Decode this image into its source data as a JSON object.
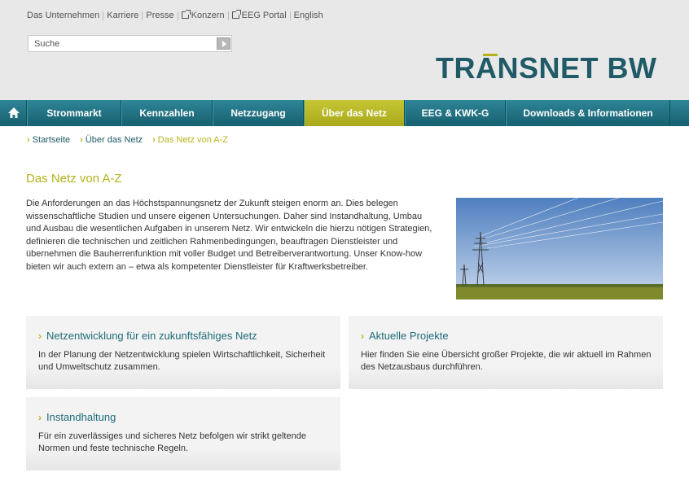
{
  "header": {
    "top_links": [
      {
        "label": "Das Unternehmen",
        "external": false
      },
      {
        "label": "Karriere",
        "external": false
      },
      {
        "label": "Presse",
        "external": false
      },
      {
        "label": "Konzern",
        "external": true
      },
      {
        "label": "EEG Portal",
        "external": true
      },
      {
        "label": "English",
        "external": false
      }
    ],
    "search": {
      "placeholder": "Suche"
    },
    "logo": {
      "text": "TRANSNET BW"
    }
  },
  "nav": {
    "home_icon": "home-icon",
    "items": [
      {
        "label": "Strommarkt",
        "active": false
      },
      {
        "label": "Kennzahlen",
        "active": false
      },
      {
        "label": "Netzzugang",
        "active": false
      },
      {
        "label": "Über das Netz",
        "active": true
      },
      {
        "label": "EEG & KWK-G",
        "active": false
      },
      {
        "label": "Downloads & Informationen",
        "active": false
      }
    ]
  },
  "breadcrumb": [
    {
      "label": "Startseite"
    },
    {
      "label": "Über das Netz"
    },
    {
      "label": "Das Netz von A-Z"
    }
  ],
  "main": {
    "title": "Das Netz von A-Z",
    "intro": "Die Anforderungen an das Höchstspannungsnetz der Zukunft steigen enorm an. Dies belegen wissenschaftliche Studien und unsere eigenen Untersuchungen. Daher sind Instandhaltung, Umbau und Ausbau die wesentlichen Aufgaben in unserem Netz. Wir entwickeln die hierzu nötigen Strategien, definieren die technischen und zeitlichen Rahmenbedingungen, beauftragen Dienstleister und übernehmen die Bauherrenfunktion mit voller Budget und Betreiberverantwortung. Unser Know-how bieten wir auch extern an – etwa als kompetenter Dienstleister für Kraftwerksbetreiber.",
    "boxes": [
      {
        "title": "Netzentwicklung für ein zukunftsfähiges Netz",
        "text": "In der Planung der Netzentwicklung spielen Wirtschaftlichkeit, Sicherheit und Umweltschutz zusammen."
      },
      {
        "title": "Aktuelle Projekte",
        "text": "Hier finden Sie eine Übersicht großer Projekte, die wir aktuell im Rahmen des Netzausbaus durchführen."
      },
      {
        "title": "Instandhaltung",
        "text": "Für ein zuverlässiges und sicheres Netz befolgen wir strikt geltende Normen und feste technische Regeln."
      }
    ]
  },
  "colors": {
    "nav_teal": "#1f6f80",
    "accent_olive": "#b3b21a",
    "logo_teal": "#1f5a66"
  }
}
